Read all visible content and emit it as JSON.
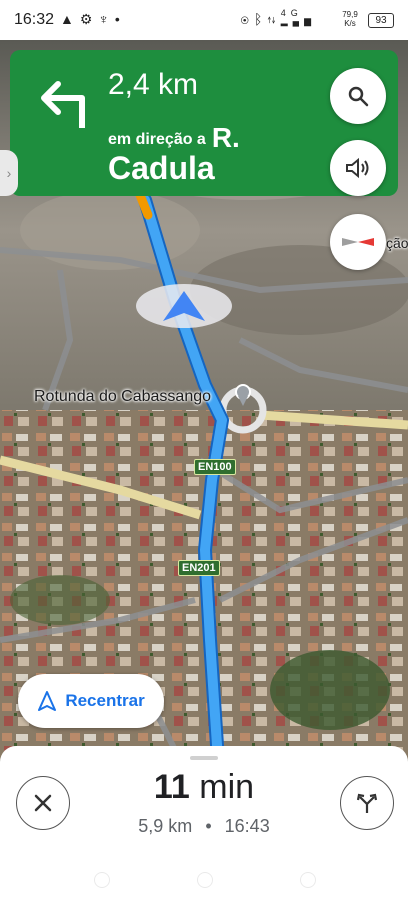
{
  "status_bar": {
    "time": "16:32",
    "left_icons": [
      "navigation-arrow-icon",
      "settings-icon",
      "trophy-icon",
      "dot-icon"
    ],
    "right_icons": [
      "location-icon",
      "bluetooth-icon",
      "data-arrows-icon",
      "signal-icon"
    ],
    "network": "4G",
    "speed_value": "79,9",
    "speed_unit": "K/s",
    "battery": "93"
  },
  "navigation": {
    "distance": "2,4 km",
    "toward_label": "em direção a",
    "street_prefix": "R.",
    "street_name": "Cadula",
    "turn_icon": "turn-left-icon"
  },
  "map": {
    "place_label": "Rotunda do Cabassango",
    "road_shields": [
      "EN100",
      "EN201"
    ],
    "edge_label_right": "ção"
  },
  "buttons": {
    "search_icon": "search-icon",
    "sound_icon": "volume-icon",
    "compass_icon": "compass-icon",
    "recenter_label": "Recentrar"
  },
  "trip": {
    "eta_value": "11",
    "eta_unit": "min",
    "distance": "5,9 km",
    "separator": "•",
    "arrival_time": "16:43"
  },
  "colors": {
    "nav_green": "#1e8e3e",
    "route_blue": "#4285f4",
    "accent_blue": "#1a73e8"
  }
}
